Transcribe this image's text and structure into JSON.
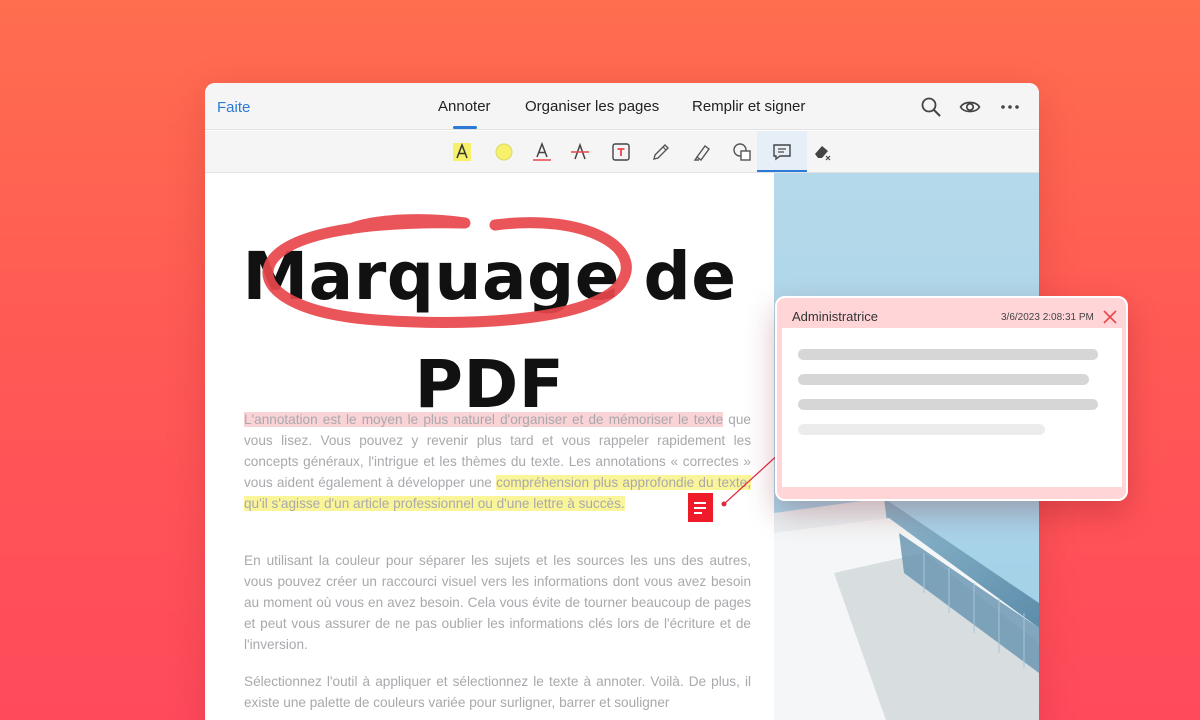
{
  "header": {
    "done_label": "Faite",
    "tabs": [
      {
        "label": "Annoter",
        "active": true
      },
      {
        "label": "Organiser les pages",
        "active": false
      },
      {
        "label": "Remplir et signer",
        "active": false
      }
    ],
    "icons": [
      "search-icon",
      "eye-icon",
      "more-icon"
    ]
  },
  "toolbar": {
    "tools": [
      {
        "name": "highlight-text-tool",
        "icon": "text-highlight-icon"
      },
      {
        "name": "highlight-area-tool",
        "icon": "circle-highlight-icon"
      },
      {
        "name": "underline-tool",
        "icon": "underline-icon"
      },
      {
        "name": "strikethrough-tool",
        "icon": "strikethrough-icon"
      },
      {
        "name": "textbox-tool",
        "icon": "textbox-icon"
      },
      {
        "name": "pencil-tool",
        "icon": "pencil-icon"
      },
      {
        "name": "marker-tool",
        "icon": "marker-icon"
      },
      {
        "name": "shapes-tool",
        "icon": "shapes-icon"
      },
      {
        "name": "comment-tool",
        "icon": "comment-icon",
        "active": true
      },
      {
        "name": "eraser-tool",
        "icon": "eraser-icon"
      }
    ]
  },
  "document": {
    "title_line1": "Marquage de",
    "title_line2": "PDF",
    "para1": {
      "pink": "L'annotation est le moyen le plus naturel d'organiser et de mémoriser le texte",
      "plain": " que vous lisez. Vous pouvez y revenir plus tard et vous rappeler rapidement les concepts généraux, l'intrigue et les thèmes du texte. Les annotations « correctes » vous aident également à développer une ",
      "yellow": "compréhension plus approfondie du texte, qu'il s'agisse d'un article professionnel ou d'une lettre à succès. "
    },
    "para2": "En utilisant la couleur pour séparer les sujets et les sources les uns des autres, vous pouvez créer un raccourci visuel vers les informations dont vous avez besoin au moment où vous en avez besoin. Cela vous évite de tourner beaucoup de pages et peut vous assurer de ne pas oublier les informations clés lors de l'écriture et de l'inversion.",
    "para3": "Sélectionnez l'outil à appliquer et sélectionnez le texte à annoter. Voilà. De plus, il existe une palette de couleurs variée pour surligner, barrer et souligner"
  },
  "comment": {
    "author": "Administratrice",
    "date": "3/6/2023 2:08:31 PM"
  },
  "colors": {
    "accent": "#2a7ad6",
    "highlight_yellow": "#fbf59a",
    "highlight_pink": "#f9d3d6",
    "markup_red": "#e8474c",
    "note_red": "#ee1c2b",
    "comment_bg": "#ffd5d7"
  }
}
